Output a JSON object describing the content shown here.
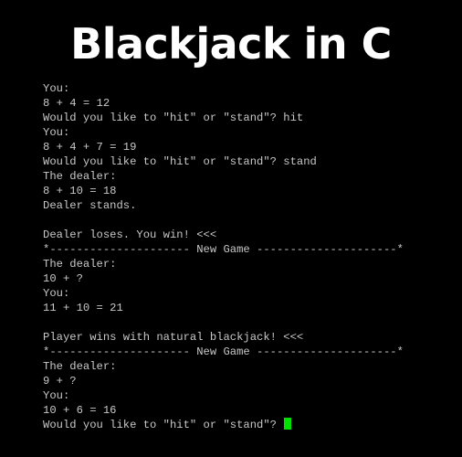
{
  "title": "Blackjack in C",
  "terminal": {
    "lines": [
      "You:",
      "8 + 4 = 12",
      "Would you like to \"hit\" or \"stand\"? hit",
      "You:",
      "8 + 4 + 7 = 19",
      "Would you like to \"hit\" or \"stand\"? stand",
      "The dealer:",
      "8 + 10 = 18",
      "Dealer stands.",
      "",
      "Dealer loses. You win! <<<",
      "*--------------------- New Game ---------------------*",
      "The dealer:",
      "10 + ?",
      "You:",
      "11 + 10 = 21",
      "",
      "Player wins with natural blackjack! <<<",
      "*--------------------- New Game ---------------------*",
      "The dealer:",
      "9 + ?",
      "You:",
      "10 + 6 = 16"
    ],
    "prompt": "Would you like to \"hit\" or \"stand\"? "
  },
  "colors": {
    "background": "#000000",
    "text": "#c8c8c8",
    "cursor": "#00e000"
  }
}
